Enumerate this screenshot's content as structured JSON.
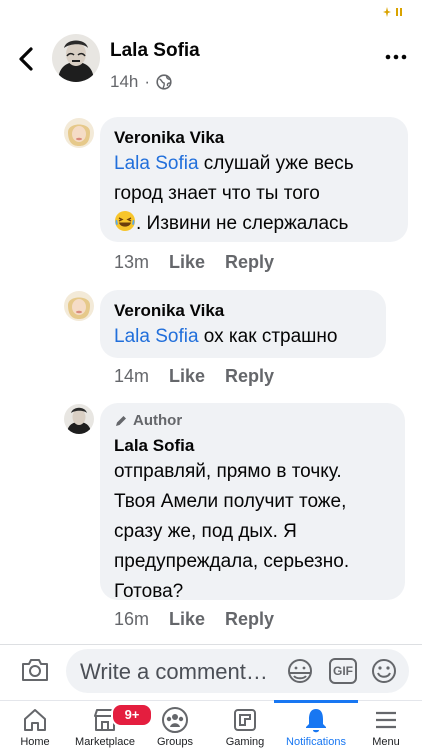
{
  "post": {
    "author": "Lala Sofia",
    "time": "14h",
    "separator": "·"
  },
  "comments": [
    {
      "name": "Veronika Vika",
      "mention": "Lala Sofia",
      "text_line1": " слушай уже весь",
      "text_line2": "город знает что ты того",
      "text_line3": ". Извини не слержалась",
      "time": "13m",
      "like": "Like",
      "reply": "Reply"
    },
    {
      "name": "Veronika Vika",
      "mention": "Lala Sofia",
      "text": " ох как страшно",
      "time": "14m",
      "like": "Like",
      "reply": "Reply"
    },
    {
      "badge": "Author",
      "name": "Lala Sofia",
      "lines": [
        "отправляй, прямо в  точку.",
        "Твоя Амели получит тоже,",
        "сразу же, под дых. Я",
        "предупреждала, серьезно.",
        "Готова?"
      ],
      "time": "16m",
      "like": "Like",
      "reply": "Reply"
    }
  ],
  "composer": {
    "placeholder": "Write a comment…",
    "gif_label": "GIF"
  },
  "nav": {
    "home": "Home",
    "marketplace": "Marketplace",
    "marketplace_badge": "9+",
    "groups": "Groups",
    "gaming": "Gaming",
    "notifications": "Notifications",
    "menu": "Menu"
  },
  "colors": {
    "accent": "#1877f2",
    "mention": "#216fdb",
    "bubble": "#f0f2f5",
    "secondary_text": "#65676b",
    "badge": "#e41e3f"
  },
  "icons": [
    "status-sparkle-icon",
    "back-arrow-icon",
    "globe-icon",
    "more-icon",
    "laughing-emoji-icon",
    "pencil-icon",
    "camera-icon",
    "sticker-icon",
    "gif-icon",
    "emoji-icon",
    "home-icon",
    "marketplace-icon",
    "groups-icon",
    "gaming-icon",
    "bell-icon",
    "menu-icon"
  ]
}
